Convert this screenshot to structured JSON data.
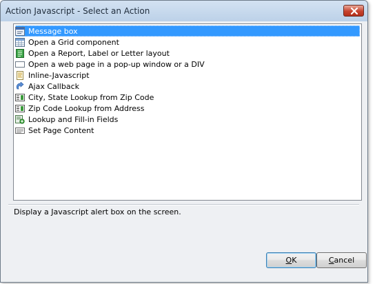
{
  "window": {
    "title": "Action Javascript - Select an Action"
  },
  "actions": [
    {
      "label": "Message box",
      "icon": "message-box-icon",
      "selected": true
    },
    {
      "label": "Open a Grid component",
      "icon": "grid-icon",
      "selected": false
    },
    {
      "label": "Open a Report, Label or Letter layout",
      "icon": "report-icon",
      "selected": false
    },
    {
      "label": "Open a web page in a pop-up window or a DIV",
      "icon": "window-icon",
      "selected": false
    },
    {
      "label": "Inline-Javascript",
      "icon": "script-icon",
      "selected": false
    },
    {
      "label": "Ajax Callback",
      "icon": "callback-icon",
      "selected": false
    },
    {
      "label": "City, State Lookup from Zip Code",
      "icon": "lookup-icon",
      "selected": false
    },
    {
      "label": "Zip Code Lookup from Address",
      "icon": "lookup-icon",
      "selected": false
    },
    {
      "label": "Lookup and Fill-in Fields",
      "icon": "fill-in-icon",
      "selected": false
    },
    {
      "label": "Set Page Content",
      "icon": "page-content-icon",
      "selected": false
    }
  ],
  "description": "Display a Javascript alert box on the screen.",
  "buttons": {
    "ok": {
      "pre": "",
      "accel": "O",
      "post": "K"
    },
    "cancel": {
      "pre": "",
      "accel": "C",
      "post": "ancel"
    }
  },
  "colors": {
    "selection": "#3399ff",
    "titlebar": "#c9dbee",
    "close": "#c7442f"
  }
}
